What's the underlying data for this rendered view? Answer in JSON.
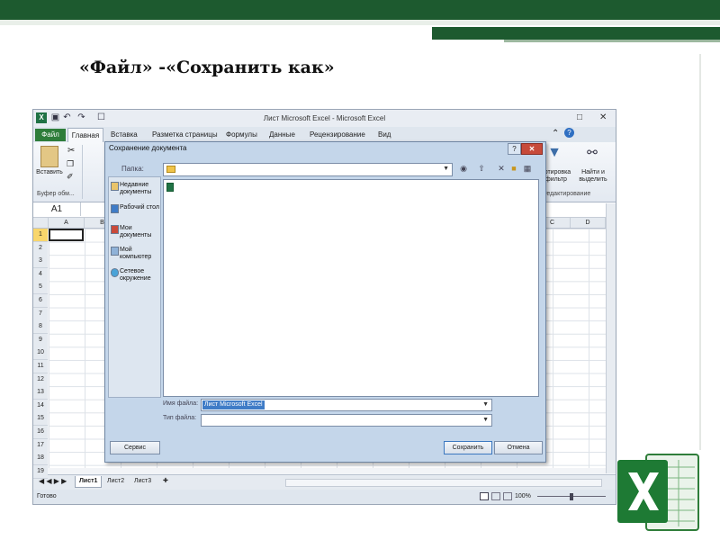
{
  "slide": {
    "title": "«Файл» -«Сохранить как»",
    "colors": {
      "accent": "#1d5a2f",
      "excel": "#217346"
    }
  },
  "excel": {
    "window_title": "Лист Microsoft Excel - Microsoft Excel",
    "quick_access_icons": [
      "save-icon",
      "undo-icon",
      "redo-icon",
      "print-preview-icon"
    ],
    "window_controls": [
      "minimize-icon",
      "restore-icon",
      "close-icon"
    ],
    "tabs": [
      "Файл",
      "Главная",
      "Вставка",
      "Разметка страницы",
      "Формулы",
      "Данные",
      "Рецензирование",
      "Вид"
    ],
    "active_tab": "Главная",
    "ribbon": {
      "paste_label": "Вставить",
      "clipboard_group": "Буфер обм...",
      "sort_filter_label": "Сортировка и фильтр",
      "find_select_label": "Найти и выделить",
      "editing_group": "Редактирование"
    },
    "name_box": "A1",
    "columns": [
      "A",
      "B",
      "C",
      "D"
    ],
    "rows": [
      "1",
      "2",
      "3",
      "4",
      "5",
      "6",
      "7",
      "8",
      "9",
      "10",
      "11",
      "12",
      "13",
      "14",
      "15",
      "16",
      "17",
      "18",
      "19"
    ],
    "sheet_tabs": [
      "Лист1",
      "Лист2",
      "Лист3"
    ],
    "active_sheet": "Лист1",
    "status": "Готово",
    "zoom": "100%"
  },
  "dialog": {
    "title": "Сохранение документа",
    "folder_label": "Папка:",
    "places": [
      {
        "label": "Недавние документы",
        "icon": "recent-documents-icon"
      },
      {
        "label": "Рабочий стол",
        "icon": "desktop-icon"
      },
      {
        "label": "Мои документы",
        "icon": "my-documents-icon"
      },
      {
        "label": "Мой компьютер",
        "icon": "my-computer-icon"
      },
      {
        "label": "Сетевое окружение",
        "icon": "network-icon"
      }
    ],
    "file_name_label": "Имя файла:",
    "file_name_value": "Лист Microsoft Excel",
    "file_type_label": "Тип файла:",
    "file_type_value": "",
    "buttons": {
      "service": "Сервис",
      "save": "Сохранить",
      "cancel": "Отмена"
    }
  }
}
